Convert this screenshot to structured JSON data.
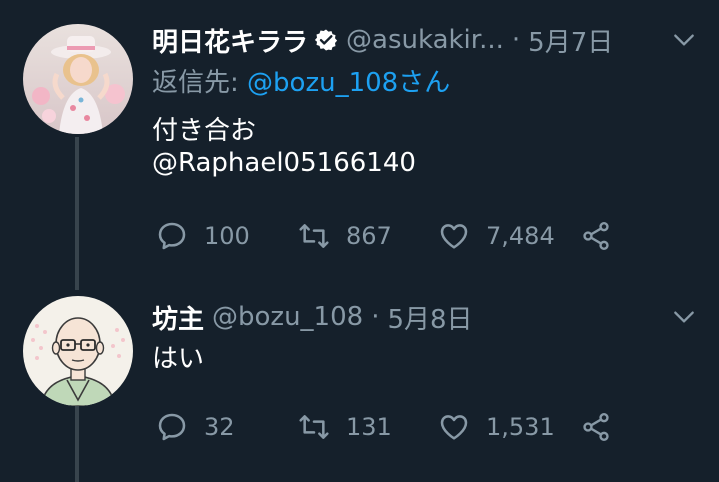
{
  "tweets": [
    {
      "name": "明日花キララ",
      "handle": "@asukakir...",
      "separator": "·",
      "date": "5月7日",
      "reply_label": "返信先: ",
      "reply_to": "@bozu_108さん",
      "text": "付き合お",
      "mention": "@Raphael05166140",
      "counts": {
        "replies": "100",
        "retweets": "867",
        "likes": "7,484"
      },
      "verified": true
    },
    {
      "name": "坊主",
      "handle": "@bozu_108",
      "separator": "·",
      "date": "5月8日",
      "text": "はい",
      "counts": {
        "replies": "32",
        "retweets": "131",
        "likes": "1,531"
      },
      "verified": false
    }
  ],
  "colors": {
    "background": "#15202b",
    "text_primary": "#ffffff",
    "text_secondary": "#8899a6",
    "link": "#1da1f2",
    "thread_line": "#38444d"
  },
  "icons": [
    "verified-badge-icon",
    "chevron-down-icon",
    "reply-icon",
    "retweet-icon",
    "like-icon",
    "share-icon"
  ]
}
